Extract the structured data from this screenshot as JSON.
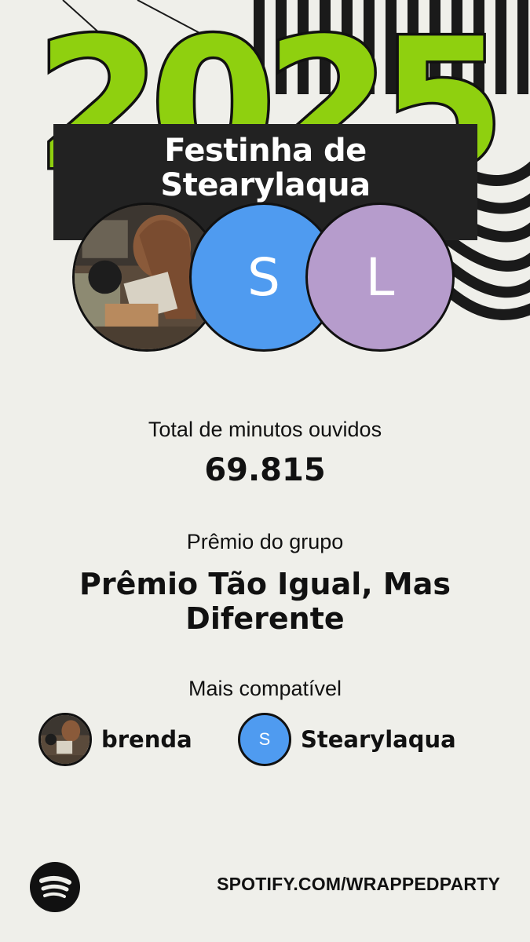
{
  "header": {
    "year": "2025",
    "title_line1": "Festinha de",
    "title_line2": "Stearylaqua"
  },
  "members": [
    {
      "kind": "photo",
      "icon": "album-cover-photo"
    },
    {
      "initial": "S",
      "color": "#4f9bf0"
    },
    {
      "initial": "L",
      "color": "#b69ccc"
    }
  ],
  "stats": {
    "minutes_label": "Total de minutos ouvidos",
    "minutes_value": "69.815",
    "award_label": "Prêmio do grupo",
    "award_line1": "Prêmio Tão Igual, Mas",
    "award_line2": "Diferente"
  },
  "compatibility": {
    "label": "Mais compatível",
    "users": [
      {
        "name": "brenda",
        "avatar": "photo"
      },
      {
        "name": "Stearylaqua",
        "initial": "S"
      }
    ]
  },
  "footer": {
    "url": "SPOTIFY.COM/WRAPPEDPARTY",
    "logo_icon": "spotify-logo-icon"
  },
  "colors": {
    "background": "#efefea",
    "accent_green": "#8fd00f",
    "blue": "#4f9bf0",
    "purple": "#b69ccc",
    "dark": "#222222"
  }
}
